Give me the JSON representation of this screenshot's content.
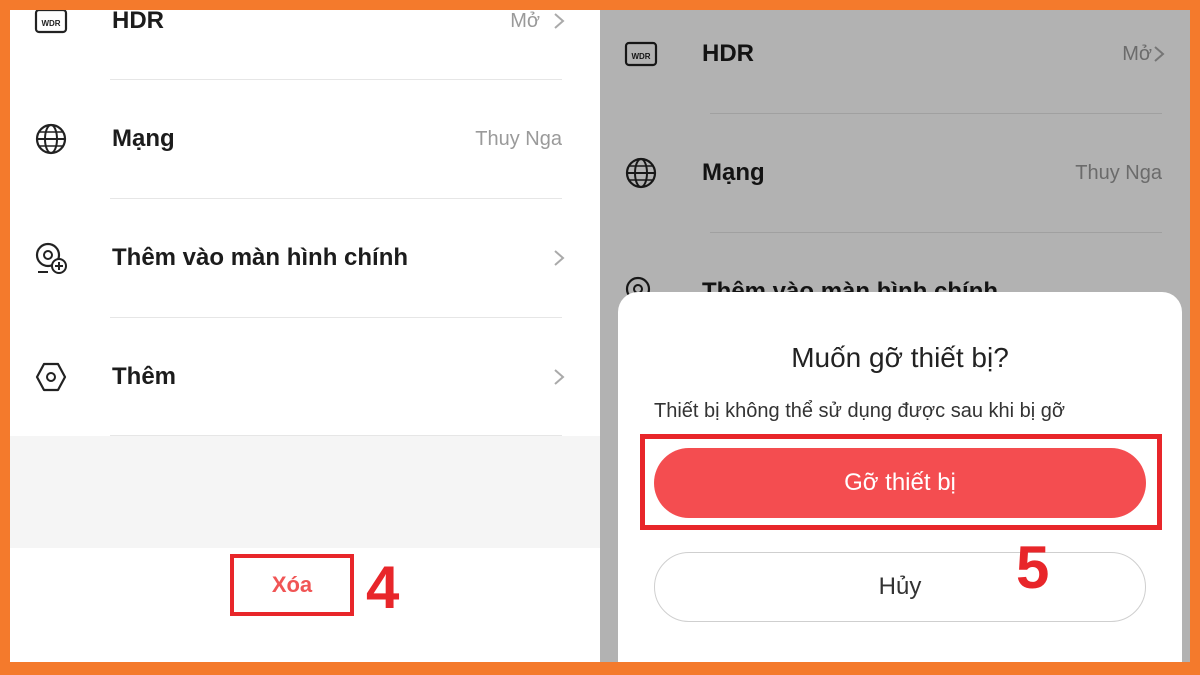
{
  "left": {
    "settings": [
      {
        "label": "HDR",
        "value": "Mở",
        "icon": "wdr-icon"
      },
      {
        "label": "Mạng",
        "value": "Thuy Nga",
        "icon": "globe-icon"
      },
      {
        "label": "Thêm vào màn hình chính",
        "value": "",
        "icon": "add-home-icon"
      },
      {
        "label": "Thêm",
        "value": "",
        "icon": "hexagon-icon"
      }
    ],
    "delete_label": "Xóa",
    "step_label": "4"
  },
  "right": {
    "settings": [
      {
        "label": "HDR",
        "value": "Mở"
      },
      {
        "label": "Mạng",
        "value": "Thuy Nga"
      },
      {
        "label": "Thêm vào màn hình chính",
        "value": ""
      }
    ],
    "dialog": {
      "title": "Muốn gỡ thiết bị?",
      "message": "Thiết bị không thể sử dụng được sau khi bị gỡ",
      "confirm_label": "Gỡ thiết bị",
      "cancel_label": "Hủy"
    },
    "step_label": "5"
  },
  "colors": {
    "frame": "#f47a2c",
    "highlight": "#e8262a",
    "confirm": "#f44d50"
  }
}
